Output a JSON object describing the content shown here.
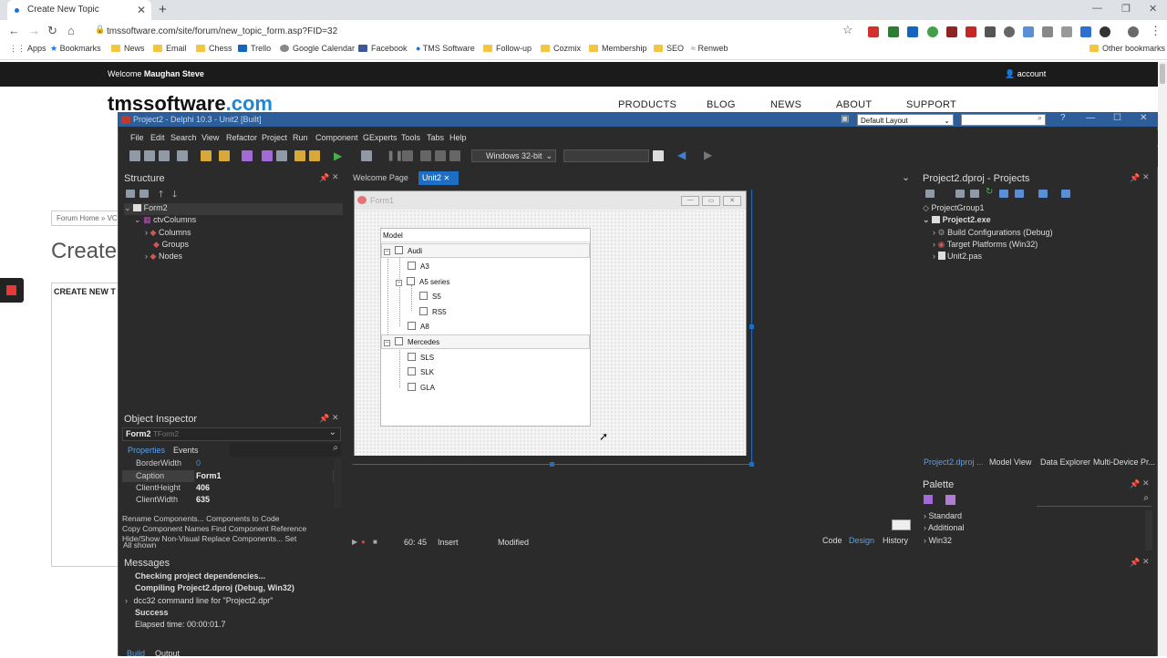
{
  "browser": {
    "tab_title": "Create New Topic",
    "new_tab": "+",
    "url": "tmssoftware.com/site/forum/new_topic_form.asp?FID=32",
    "bookmarks": [
      "Apps",
      "Bookmarks",
      "News",
      "Email",
      "Chess",
      "Trello",
      "Google Calendar",
      "Facebook",
      "TMS Software",
      "Follow-up",
      "Cozmix",
      "Membership",
      "SEO",
      "Renweb"
    ],
    "other_bookmarks": "Other bookmarks"
  },
  "site": {
    "welcome_prefix": "Welcome",
    "welcome_user": "Maughan Steve",
    "account": "account",
    "logo_main": "tmssoftware",
    "logo_dot": ".com",
    "nav": [
      "PRODUCTS",
      "BLOG",
      "NEWS",
      "ABOUT",
      "SUPPORT"
    ],
    "breadcrumb": "Forum Home » VC",
    "heading": "Create",
    "new_topic": "CREATE NEW T"
  },
  "ide": {
    "title": "Project2 - Delphi 10.3 - Unit2 [Built]",
    "layout": "Default Layout",
    "menu": [
      "File",
      "Edit",
      "Search",
      "View",
      "Refactor",
      "Project",
      "Run",
      "Component",
      "GExperts",
      "Tools",
      "Tabs",
      "Help"
    ],
    "platform": "Windows 32-bit",
    "structure": {
      "title": "Structure",
      "tree": [
        {
          "label": "Form2",
          "level": 0
        },
        {
          "label": "ctvColumns",
          "level": 1
        },
        {
          "label": "Columns",
          "level": 2
        },
        {
          "label": "Groups",
          "level": 2
        },
        {
          "label": "Nodes",
          "level": 2
        }
      ]
    },
    "object_inspector": {
      "title": "Object Inspector",
      "object": "Form2",
      "object_type": "TForm2",
      "tab_properties": "Properties",
      "tab_events": "Events",
      "rows": [
        {
          "key": "BorderWidth",
          "value": "0"
        },
        {
          "key": "Caption",
          "value": "Form1"
        },
        {
          "key": "ClientHeight",
          "value": "406"
        },
        {
          "key": "ClientWidth",
          "value": "635"
        }
      ],
      "links_line1": "Rename Components...  Components to Code",
      "links_line2": "Copy Component Names  Find Component Reference",
      "links_line3": "Hide/Show Non-Visual  Replace Components...  Set FocusControl",
      "all_shown": "All shown"
    },
    "editor_tabs": {
      "welcome": "Welcome Page",
      "unit": "Unit2"
    },
    "form": {
      "caption": "Form1",
      "column": "Model",
      "groups": [
        {
          "label": "Audi",
          "children": [
            "A3",
            "A5 series",
            "S5",
            "RS5",
            "A8"
          ]
        },
        {
          "label": "Mercedes",
          "children": [
            "SLS",
            "SLK",
            "GLA"
          ]
        }
      ]
    },
    "design_status": {
      "position": "60: 45",
      "mode": "Insert",
      "state": "Modified",
      "tabs": [
        "Code",
        "Design",
        "History"
      ]
    },
    "projects": {
      "title": "Project2.dproj - Projects",
      "tree": [
        "ProjectGroup1",
        "Project2.exe",
        "Build Configurations (Debug)",
        "Target Platforms (Win32)",
        "Unit2.pas"
      ],
      "tabs": [
        "Project2.dproj ...",
        "Model View",
        "Data Explorer",
        "Multi-Device Pr..."
      ]
    },
    "palette": {
      "title": "Palette",
      "items": [
        "Standard",
        "Additional",
        "Win32"
      ]
    },
    "messages": {
      "title": "Messages",
      "lines": [
        "Checking project dependencies...",
        "Compiling Project2.dproj (Debug, Win32)",
        "dcc32 command line for \"Project2.dpr\"",
        "Success",
        "Elapsed time: 00:00:01.7"
      ],
      "tabs": [
        "Build",
        "Output"
      ]
    }
  },
  "colors": {
    "accent": "#1e6fc4",
    "ide_bg": "#2b2b2b",
    "titlebar": "#2d5e9a",
    "site_dark": "#1b1b1b",
    "logo_com": "#1e88d8"
  }
}
